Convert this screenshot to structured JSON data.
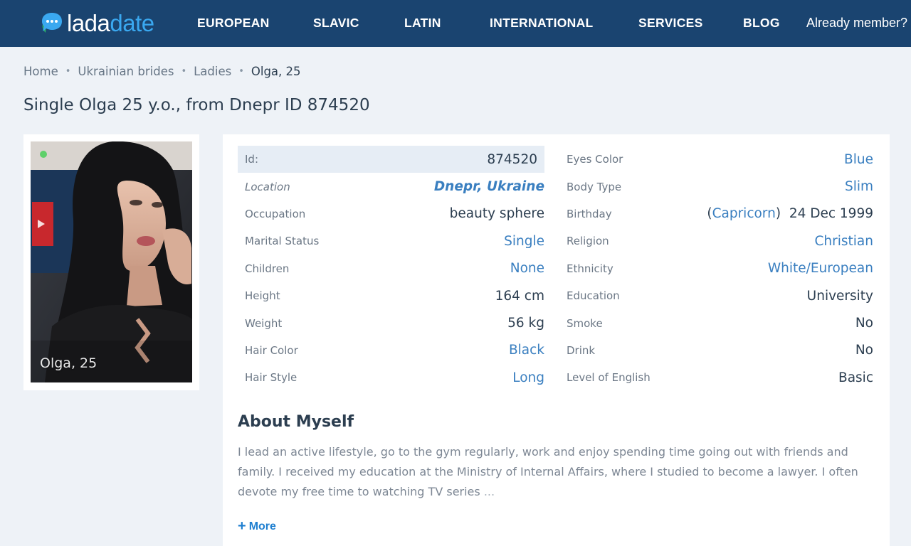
{
  "header": {
    "logo_part1": "lada",
    "logo_part2": "date",
    "nav": [
      "EUROPEAN",
      "SLAVIC",
      "LATIN",
      "INTERNATIONAL",
      "SERVICES",
      "BLOG"
    ],
    "member_link": "Already member?"
  },
  "breadcrumb": [
    "Home",
    "Ukrainian brides",
    "Ladies",
    "Olga, 25"
  ],
  "page_title": "Single Olga 25 y.o., from Dnepr ID 874520",
  "photo": {
    "caption": "Olga, 25"
  },
  "profile_left": [
    {
      "label": "Id:",
      "value": "874520"
    },
    {
      "label": "Location",
      "value": "Dnepr, Ukraine"
    },
    {
      "label": "Occupation",
      "value": "beauty sphere"
    },
    {
      "label": "Marital Status",
      "value": "Single"
    },
    {
      "label": "Children",
      "value": "None"
    },
    {
      "label": "Height",
      "value": "164 cm"
    },
    {
      "label": "Weight",
      "value": "56 kg"
    },
    {
      "label": "Hair Color",
      "value": "Black"
    },
    {
      "label": "Hair Style",
      "value": "Long"
    }
  ],
  "profile_right": [
    {
      "label": "Eyes Color",
      "value": "Blue"
    },
    {
      "label": "Body Type",
      "value": "Slim"
    },
    {
      "label": "Birthday",
      "sign": "Capricorn",
      "date": "24 Dec 1999"
    },
    {
      "label": "Religion",
      "value": "Christian"
    },
    {
      "label": "Ethnicity",
      "value": "White/European"
    },
    {
      "label": "Education",
      "value": "University"
    },
    {
      "label": "Smoke",
      "value": "No"
    },
    {
      "label": "Drink",
      "value": "No"
    },
    {
      "label": "Level of English",
      "value": "Basic"
    }
  ],
  "about": {
    "title": "About Myself",
    "text": "I lead an active lifestyle, go to the gym regularly, work and enjoy spending time going out with friends and family. I received my education at the Ministry of Internal Affairs, where I studied to become a lawyer. I often devote my free time to watching TV series",
    "ellipsis": "...",
    "more_label": "More"
  },
  "colors": {
    "header_bg": "#1a4470",
    "accent_blue": "#3aa8f0",
    "link": "#3a7fc0",
    "page_bg": "#eef2f7"
  }
}
